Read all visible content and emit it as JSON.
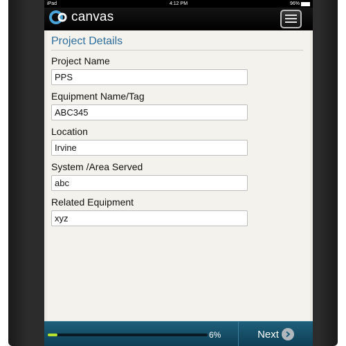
{
  "status_bar": {
    "carrier": "iPad",
    "time": "4:12 PM",
    "battery": "96%"
  },
  "header": {
    "app_name": "canvas",
    "logo_icon": "canvas-logo-icon",
    "menu_icon": "menu-icon"
  },
  "form": {
    "title": "Project Details",
    "fields": [
      {
        "label": "Project Name",
        "value": "PPS"
      },
      {
        "label": "Equipment Name/Tag",
        "value": "ABC345"
      },
      {
        "label": "Location",
        "value": "Irvine"
      },
      {
        "label": "System /Area Served",
        "value": "abc"
      },
      {
        "label": "Related Equipment",
        "value": "xyz"
      }
    ]
  },
  "footer": {
    "progress_fraction": 0.06,
    "progress_label": "6%",
    "next_label": "Next",
    "next_icon": "chevron-right-circle-icon"
  },
  "colors": {
    "title_blue": "#2e6d9c",
    "footer_blue": "#1e5f7a",
    "progress_green": "#b8e32a"
  }
}
